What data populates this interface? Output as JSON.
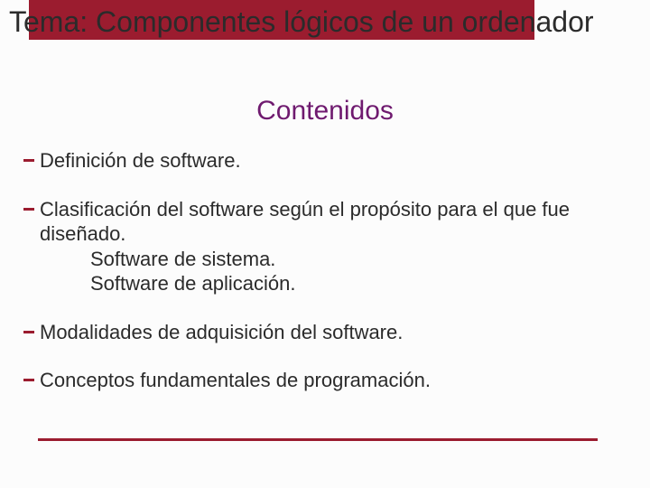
{
  "title": "Tema: Componentes lógicos de un ordenador",
  "subtitle": "Contenidos",
  "items": {
    "p1": "Definición de software.",
    "p2": "Clasificación del software según el propósito para el que fue diseñado.",
    "p2a": "Software de sistema.",
    "p2b": "Software de aplicación.",
    "p3": "Modalidades de adquisición del software.",
    "p4": "Conceptos fundamentales de programación."
  }
}
